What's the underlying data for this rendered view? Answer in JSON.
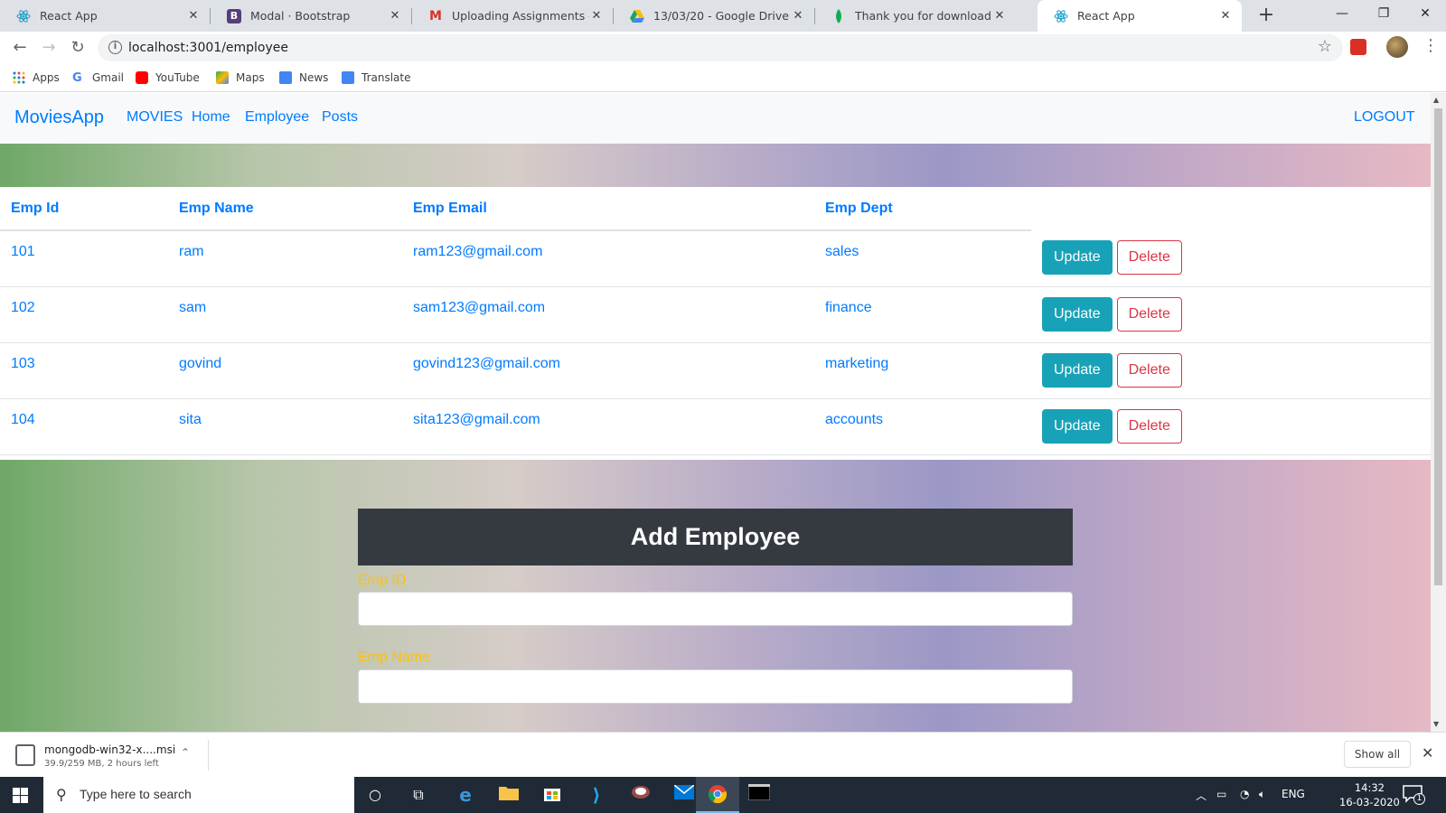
{
  "browser": {
    "tabs": [
      {
        "title": "React App",
        "icon": "react-icon",
        "active": false
      },
      {
        "title": "Modal · Bootstrap",
        "icon": "bootstrap-icon",
        "active": false
      },
      {
        "title": "Uploading Assignments - hynd",
        "icon": "gmail-icon",
        "active": false
      },
      {
        "title": "13/03/20 - Google Drive",
        "icon": "google-drive-icon",
        "active": false
      },
      {
        "title": "Thank you for downloading Mc",
        "icon": "mongodb-leaf-icon",
        "active": false
      },
      {
        "title": "React App",
        "icon": "react-icon",
        "active": true
      }
    ],
    "url": "localhost:3001/employee",
    "bookmarks": [
      "Apps",
      "Gmail",
      "YouTube",
      "Maps",
      "News",
      "Translate"
    ]
  },
  "app": {
    "brand": "MoviesApp",
    "nav": [
      "MOVIES",
      "Home",
      "Employee",
      "Posts"
    ],
    "logout": "LOGOUT"
  },
  "table": {
    "headers": [
      "Emp Id",
      "Emp Name",
      "Emp Email",
      "Emp Dept"
    ],
    "rows": [
      {
        "id": "101",
        "name": "ram",
        "email": "ram123@gmail.com",
        "dept": "sales"
      },
      {
        "id": "102",
        "name": "sam",
        "email": "sam123@gmail.com",
        "dept": "finance"
      },
      {
        "id": "103",
        "name": "govind",
        "email": "govind123@gmail.com",
        "dept": "marketing"
      },
      {
        "id": "104",
        "name": "sita",
        "email": "sita123@gmail.com",
        "dept": "accounts"
      }
    ],
    "update_label": "Update",
    "delete_label": "Delete"
  },
  "form": {
    "title": "Add Employee",
    "fields": [
      {
        "label": "Emp ID",
        "value": ""
      },
      {
        "label": "Emp Name",
        "value": ""
      }
    ]
  },
  "downloads": {
    "file": "mongodb-win32-x....msi",
    "status": "39.9/259 MB, 2 hours left",
    "show_all": "Show all"
  },
  "taskbar": {
    "search_placeholder": "Type here to search",
    "lang": "ENG",
    "time": "14:32",
    "date": "16-03-2020",
    "notifications": "1"
  },
  "colors": {
    "link": "#007bff",
    "update_button": "#17a2b8",
    "delete_button": "#dc3545",
    "form_label": "#ffc107",
    "form_header": "#343a40"
  }
}
